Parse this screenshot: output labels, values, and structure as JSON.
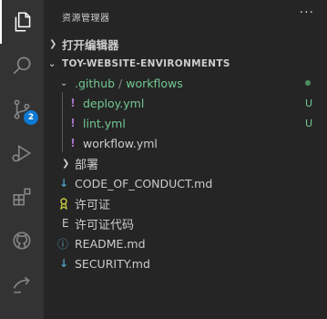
{
  "sidebar": {
    "title": "资源管理器",
    "more": "···",
    "open_editors": "打开编辑器",
    "workspace": "TOY-WEBSITE-ENVIRONMENTS"
  },
  "activity": {
    "scm_badge": "2"
  },
  "tree": {
    "github_folder": ".github",
    "sep": "/",
    "workflows_folder": "workflows",
    "deploy": "deploy.yml",
    "deploy_status": "U",
    "lint": "lint.yml",
    "lint_status": "U",
    "workflow": "workflow.yml",
    "deploy_folder": "部署",
    "code_of_conduct": "CODE_OF_CONDUCT.md",
    "license": "许可证",
    "license_code_prefix": "E",
    "license_code": "许可证代码",
    "readme": "README.md",
    "security": "SECURITY.md"
  },
  "icons": {
    "yaml": "!",
    "markdown": "↓",
    "info": "ⓘ"
  },
  "colors": {
    "activity_bar": "#333333",
    "sidebar": "#252526",
    "untracked": "#73c991",
    "badge": "#0e7ad3",
    "yaml_icon": "#a074c4",
    "md_icon": "#519aba",
    "license_icon": "#cbcb41"
  }
}
